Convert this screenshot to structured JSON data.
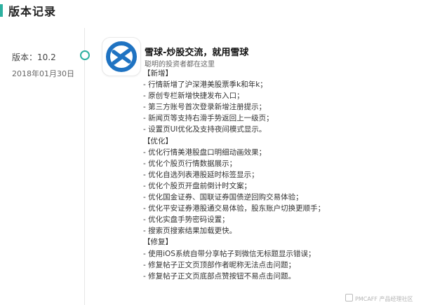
{
  "header": {
    "title": "版本记录"
  },
  "release": {
    "version": "版本：10.2",
    "date": "2018年01月30日",
    "app_name": "雪球-炒股交流，就用雪球",
    "slogan": "聪明的投资者都在这里",
    "icon": "xueqiu-logo-icon",
    "accent_color": "#2db0a0",
    "logo_color": "#1f73c2",
    "notes": [
      "【新增】",
      "- 行情新增了沪深港美股票季k和年k；",
      "- 原创专栏新增快捷发布入口；",
      "- 第三方账号首次登录新增注册提示；",
      "- 新闻页等支持右滑手势返回上一级页；",
      "- 设置页UI优化及支持夜间模式显示。",
      "【优化】",
      "- 优化行情美港股盘口明细动画效果；",
      "- 优化个股页行情数据展示；",
      "- 优化自选列表港股延时标签显示；",
      "- 优化个股页开盘前倒计时文案；",
      "- 优化国金证券、国联证券国债逆回购交易体验；",
      "- 优化平安证券港股通交易体验，股东账户切换更顺手；",
      "- 优化实盘手势密码设置；",
      "- 搜索页搜索结果加载更快。",
      "【修复】",
      "- 使用iOS系统自带分享帖子到微信无标题显示错误；",
      "- 修复帖子正文页顶部作者昵称无法点击问题；",
      "- 修复帖子正文页底部点赞按钮不易点击问题。"
    ]
  },
  "watermark": {
    "text": "PMCAFF 产品经理社区"
  }
}
